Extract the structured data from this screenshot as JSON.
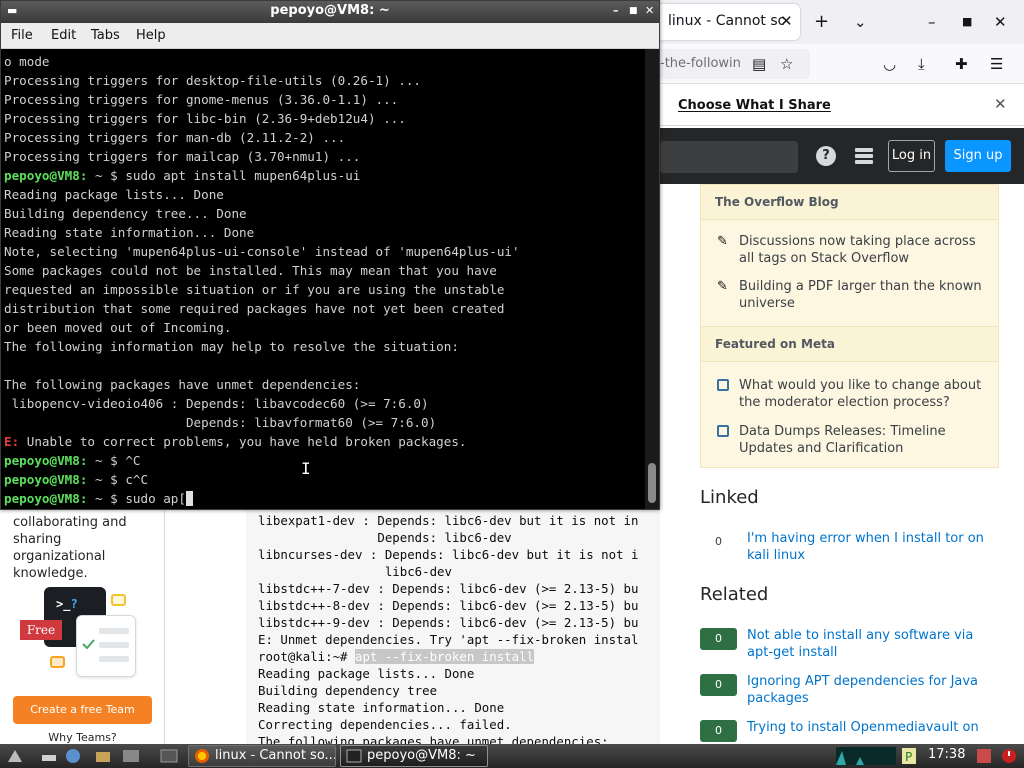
{
  "browser": {
    "tab_title": "linux - Cannot solve",
    "url_fragment": "-the-followin",
    "privacy_notice_link": "Choose What I Share",
    "site_header": {
      "login_label": "Log in",
      "signup_label": "Sign up",
      "help_symbol": "?"
    },
    "blog": {
      "heading": "The Overflow Blog",
      "items": [
        "Discussions now taking place across all tags on Stack Overflow",
        "Building a PDF larger than the known universe"
      ],
      "meta_heading": "Featured on Meta",
      "meta_items": [
        "What would you like to change about the moderator election process?",
        "Data Dumps Releases: Timeline Updates and Clarification"
      ]
    },
    "linked": {
      "heading": "Linked",
      "questions": [
        {
          "votes": "0",
          "title": "I'm having error when I install tor on kali linux"
        }
      ]
    },
    "related": {
      "heading": "Related",
      "questions": [
        {
          "votes": "0",
          "title": "Not able to install any software via apt-get install"
        },
        {
          "votes": "0",
          "title": "Ignoring APT dependencies for Java packages"
        },
        {
          "votes": "0",
          "title": "Trying to install Openmediavault on"
        }
      ]
    },
    "teams": {
      "text": "collaborating and sharing organizational knowledge.",
      "art_prompt": ">_",
      "art_question": "?",
      "free_badge": "Free",
      "button_label": "Create a free Team",
      "why_link": "Why Teams?"
    },
    "code_block": {
      "lines": [
        "libexpat1-dev : Depends: libc6-dev but it is not in",
        "                Depends: libc6-dev",
        "libncurses-dev : Depends: libc6-dev but it is not i",
        "                 libc6-dev",
        "libstdc++-7-dev : Depends: libc6-dev (>= 2.13-5) bu",
        "libstdc++-8-dev : Depends: libc6-dev (>= 2.13-5) bu",
        "libstdc++-9-dev : Depends: libc6-dev (>= 2.13-5) bu",
        "E: Unmet dependencies. Try 'apt --fix-broken instal"
      ],
      "prompt_line": "root@kali:~# ",
      "highlighted_command": "apt --fix-broken install",
      "after_lines": [
        "Reading package lists... Done",
        "Building dependency tree",
        "Reading state information... Done",
        "Correcting dependencies... failed.",
        "The following packages have unmet dependencies:"
      ]
    }
  },
  "terminal": {
    "title": "pepoyo@VM8: ~",
    "menu": [
      "File",
      "Edit",
      "Tabs",
      "Help"
    ],
    "prompt": "pepoyo@VM8:",
    "lines": [
      "o mode",
      "Processing triggers for desktop-file-utils (0.26-1) ...",
      "Processing triggers for gnome-menus (3.36.0-1.1) ...",
      "Processing triggers for libc-bin (2.36-9+deb12u4) ...",
      "Processing triggers for man-db (2.11.2-2) ...",
      "Processing triggers for mailcap (3.70+nmu1) ..."
    ],
    "cmd1": " ~ $ sudo apt install mupen64plus-ui",
    "lines2": [
      "Reading package lists... Done",
      "Building dependency tree... Done",
      "Reading state information... Done",
      "Note, selecting 'mupen64plus-ui-console' instead of 'mupen64plus-ui'",
      "Some packages could not be installed. This may mean that you have",
      "requested an impossible situation or if you are using the unstable",
      "distribution that some required packages have not yet been created",
      "or been moved out of Incoming.",
      "The following information may help to resolve the situation:",
      "",
      "The following packages have unmet dependencies:",
      " libopencv-videoio406 : Depends: libavcodec60 (>= 7:6.0)",
      "                        Depends: libavformat60 (>= 7:6.0)"
    ],
    "error_prefix": "E:",
    "error_text": " Unable to correct problems, you have held broken packages.",
    "cmd2": " ~ $ ^C",
    "cmd3": " ~ $ c^C",
    "cmd4": " ~ $ sudo ap["
  },
  "taskbar": {
    "tasks": [
      "linux - Cannot so...",
      "pepoyo@VM8: ~"
    ],
    "clock": "17:38"
  },
  "colors": {
    "prompt_green": "#5ce05c",
    "error_red": "#e04040",
    "so_orange": "#f48225",
    "so_blue": "#0a95ff",
    "accepted_green": "#2f6f44"
  }
}
